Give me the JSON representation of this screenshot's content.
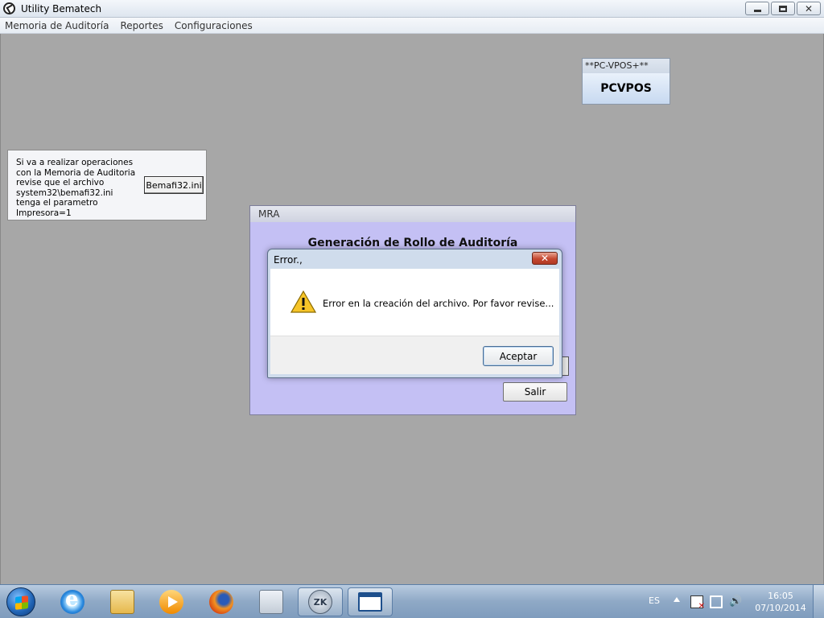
{
  "window": {
    "title": "Utility Bematech",
    "controls": {
      "minimize": "",
      "maximize": "",
      "close": "✕"
    }
  },
  "menu": {
    "items": [
      "Memoria de Auditoría",
      "Reportes",
      "Configuraciones"
    ]
  },
  "vpos_panel": {
    "caption": "**PC-VPOS+**",
    "label": "PCVPOS"
  },
  "info_box": {
    "text": "Si va a realizar operaciones con la Memoria de Auditoria revise que el archivo system32\\bemafi32.ini tenga el parametro Impresora=1",
    "button_label": "Bemafi32.ini"
  },
  "mra_window": {
    "title": "MRA",
    "heading": "Generación de Rollo de Auditoría",
    "salir_label": "Salir"
  },
  "error_dialog": {
    "title": "Error.,",
    "close": "✕",
    "message": "Error en la creación del archivo. Por favor revise...",
    "accept_label": "Aceptar",
    "icon": "warning-icon"
  },
  "taskbar": {
    "items": [
      "start-orb",
      "internet-explorer-icon",
      "windows-explorer-icon",
      "media-player-icon",
      "firefox-icon",
      "calculator-icon",
      "zkx-app-icon",
      "utility-bematech-app-icon"
    ],
    "kx_label": "ZK",
    "language": "ES",
    "volume_glyph": "🔊",
    "time": "16:05",
    "date": "07/10/2014"
  },
  "colors": {
    "desktop": "#a7a7a7",
    "mra_background": "#c4c0f4",
    "close_button": "#c54730"
  }
}
